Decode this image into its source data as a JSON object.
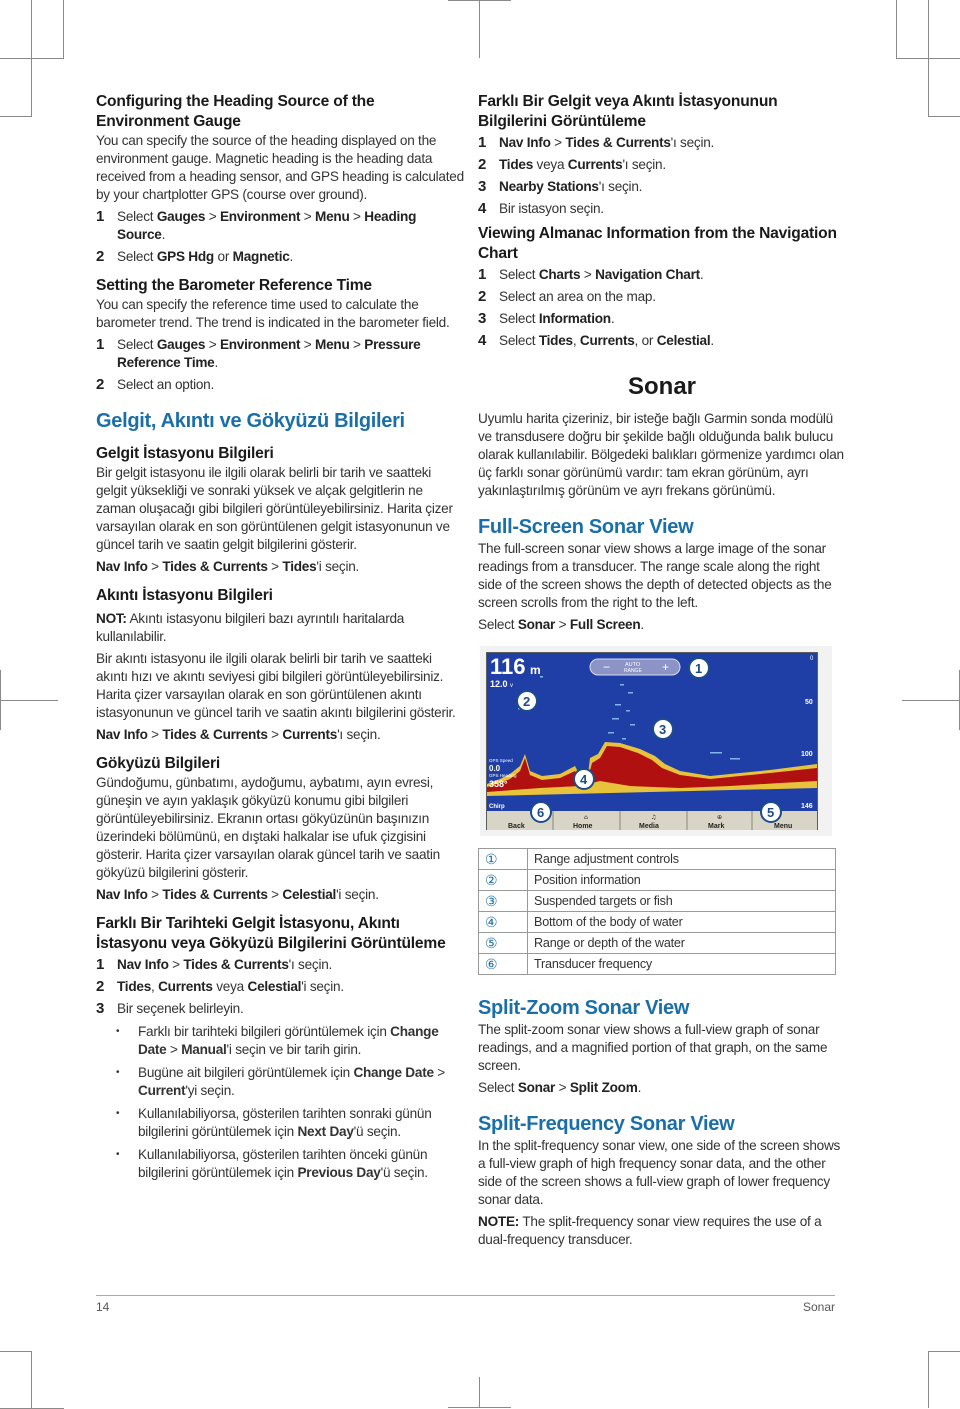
{
  "left": {
    "heading_source": {
      "title": "Configuring the Heading Source of the Environment Gauge",
      "body": "You can specify the source of the heading displayed on the environment gauge. Magnetic heading is the heading data received from a heading sensor, and GPS heading is calculated by your chartplotter GPS (course over ground).",
      "steps": [
        {
          "num": "1",
          "pre": "Select ",
          "b1": "Gauges",
          "s1": " > ",
          "b2": "Environment",
          "s2": " > ",
          "b3": "Menu",
          "s3": " > ",
          "b4": "Heading Source",
          "post": "."
        },
        {
          "num": "2",
          "pre": "Select ",
          "b1": "GPS Hdg",
          "s1": " or ",
          "b2": "Magnetic",
          "post": "."
        }
      ]
    },
    "barometer": {
      "title": "Setting the Barometer Reference Time",
      "body": "You can specify the reference time used to calculate the barometer trend. The trend is indicated in the barometer field.",
      "steps": [
        {
          "num": "1",
          "pre": "Select ",
          "b1": "Gauges",
          "s1": " > ",
          "b2": "Environment",
          "s2": " > ",
          "b3": "Menu",
          "s3": " > ",
          "b4": "Pressure Reference Time",
          "post": "."
        },
        {
          "num": "2",
          "text": "Select an option."
        }
      ]
    },
    "tides_section": {
      "title": "Gelgit, Akıntı ve Gökyüzü Bilgileri",
      "tide_station": {
        "title": "Gelgit İstasyonu Bilgileri",
        "body": "Bir gelgit istasyonu ile ilgili olarak belirli bir tarih ve saatteki gelgit yüksekliği ve sonraki yüksek ve alçak gelgitlerin ne zaman oluşacağı gibi bilgileri görüntüleyebilirsiniz. Harita çizer varsayılan olarak en son görüntülenen gelgit istasyonunun ve güncel tarih ve saatin gelgit bilgilerini gösterir.",
        "path": {
          "b1": "Nav Info",
          "s1": " > ",
          "b2": "Tides & Currents",
          "s2": " > ",
          "b3": "Tides",
          "post": "'i seçin."
        }
      },
      "current_station": {
        "title": "Akıntı İstasyonu Bilgileri",
        "note_label": "NOT:",
        "note_text": " Akıntı istasyonu bilgileri bazı ayrıntılı haritalarda kullanılabilir.",
        "body": "Bir akıntı istasyonu ile ilgili olarak belirli bir tarih ve saatteki akıntı hızı ve akıntı seviyesi gibi bilgileri görüntüleyebilirsiniz. Harita çizer varsayılan olarak en son görüntülenen akıntı istasyonunun ve güncel tarih ve saatin akıntı bilgilerini gösterir.",
        "path": {
          "b1": "Nav Info",
          "s1": " > ",
          "b2": "Tides & Currents",
          "s2": " > ",
          "b3": "Currents",
          "post": "'ı seçin."
        }
      },
      "celestial": {
        "title": "Gökyüzü Bilgileri",
        "body": "Gündoğumu, günbatımı, aydoğumu, aybatımı, ayın evresi, güneşin ve ayın yaklaşık gökyüzü konumu gibi bilgileri görüntüleyebilirsiniz. Ekranın ortası gökyüzünün başınızın üzerindeki bölümünü, en dıştaki halkalar ise ufuk çizgisini gösterir. Harita çizer varsayılan olarak güncel tarih ve saatin gökyüzü bilgilerini gösterir.",
        "path": {
          "b1": "Nav Info",
          "s1": " > ",
          "b2": "Tides & Currents",
          "s2": " > ",
          "b3": "Celestial",
          "post": "'i seçin."
        }
      },
      "different_date": {
        "title": "Farklı Bir Tarihteki Gelgit İstasyonu, Akıntı İstasyonu veya Gökyüzü Bilgilerini Görüntüleme",
        "steps": [
          {
            "num": "1",
            "b1": "Nav Info",
            "s1": " > ",
            "b2": "Tides & Currents",
            "post": "'ı seçin."
          },
          {
            "num": "2",
            "b1": "Tides",
            "s1": ", ",
            "b2": "Currents",
            "s2": " veya ",
            "b3": "Celestial",
            "post": "'i seçin."
          },
          {
            "num": "3",
            "text": "Bir seçenek belirleyin."
          }
        ],
        "bullets": [
          {
            "pre": "Farklı bir tarihteki bilgileri görüntülemek için ",
            "b1": "Change Date",
            "s1": " > ",
            "b2": "Manual",
            "post": "'i seçin ve bir tarih girin."
          },
          {
            "pre": "Bugüne ait bilgileri görüntülemek için ",
            "b1": "Change Date",
            "s1": " > ",
            "b2": "Current",
            "post": "'yi seçin."
          },
          {
            "pre": "Kullanılabiliyorsa, gösterilen tarihten sonraki günün bilgilerini görüntülemek için ",
            "b1": "Next Day",
            "post": "'ü seçin."
          },
          {
            "pre": "Kullanılabiliyorsa, gösterilen tarihten önceki günün bilgilerini görüntülemek için ",
            "b1": "Previous Day",
            "post": "'ü seçin."
          }
        ]
      }
    }
  },
  "right": {
    "different_station": {
      "title": "Farklı Bir Gelgit veya Akıntı İstasyonunun Bilgilerini Görüntüleme",
      "steps": [
        {
          "num": "1",
          "b1": "Nav Info",
          "s1": " > ",
          "b2": "Tides & Currents",
          "post": "'ı seçin."
        },
        {
          "num": "2",
          "b1": "Tides",
          "s1": " veya ",
          "b2": "Currents",
          "post": "'ı seçin."
        },
        {
          "num": "3",
          "b1": "Nearby Stations",
          "post": "'ı seçin."
        },
        {
          "num": "4",
          "text": "Bir istasyon seçin."
        }
      ]
    },
    "almanac": {
      "title": "Viewing Almanac Information from the Navigation Chart",
      "steps": [
        {
          "num": "1",
          "pre": "Select ",
          "b1": "Charts",
          "s1": " > ",
          "b2": "Navigation Chart",
          "post": "."
        },
        {
          "num": "2",
          "text": "Select an area on the map."
        },
        {
          "num": "3",
          "pre": "Select ",
          "b1": "Information",
          "post": "."
        },
        {
          "num": "4",
          "pre": "Select ",
          "b1": "Tides",
          "s1": ", ",
          "b2": "Currents",
          "s2": ", or ",
          "b3": "Celestial",
          "post": "."
        }
      ]
    },
    "sonar": {
      "title": "Sonar",
      "intro": "Uyumlu harita çizeriniz, bir isteğe bağlı Garmin sonda modülü ve transdusere doğru bir şekilde bağlı olduğunda balık bulucu olarak kullanılabilir. Bölgedeki balıkları görmenize yardımcı olan üç farklı sonar görünümü vardır: tam ekran görünüm, ayrı yakınlaştırılmış görünüm ve ayrı frekans görünümü.",
      "full_screen": {
        "title": "Full-Screen Sonar View",
        "body": "The full-screen sonar view shows a large image of the sonar readings from a transducer. The range scale along the right side of the screen shows the depth of detected objects as the screen scrolls from the right to the left.",
        "path": {
          "pre": "Select ",
          "b1": "Sonar",
          "s1": " > ",
          "b2": "Full Screen",
          "post": "."
        }
      },
      "screenshot": {
        "depth": "116",
        "depth_unit": "m",
        "voltage": "12.0",
        "voltage_unit": "v",
        "range_minus": "−",
        "range_label_1": "AUTO",
        "range_label_2": "RANGE",
        "range_plus": "+",
        "scale": [
          "0",
          "50",
          "100",
          "146"
        ],
        "gps_speed_label": "GPS Speed",
        "gps_speed": "0.0",
        "gps_heading_label": "GPS Heading",
        "gps_heading": "358°",
        "freq_label": "Chirp",
        "callouts": [
          "1",
          "2",
          "3",
          "4",
          "5",
          "6"
        ],
        "buttons": [
          {
            "label": "Back",
            "icon": ""
          },
          {
            "label": "Home",
            "icon": "home-icon"
          },
          {
            "label": "Media",
            "icon": "music-note-icon"
          },
          {
            "label": "Mark",
            "icon": "crosshair-icon"
          },
          {
            "label": "Menu",
            "icon": ""
          }
        ],
        "colors": {
          "water": "#1f3fa6",
          "bottom": "#b01010",
          "edge": "#e8c23a",
          "fish": "#7fb6e8"
        }
      },
      "legend": [
        {
          "mark": "①",
          "text": "Range adjustment controls"
        },
        {
          "mark": "②",
          "text": "Position information"
        },
        {
          "mark": "③",
          "text": "Suspended targets or fish"
        },
        {
          "mark": "④",
          "text": "Bottom of the body of water"
        },
        {
          "mark": "⑤",
          "text": "Range or depth of the water"
        },
        {
          "mark": "⑥",
          "text": "Transducer frequency"
        }
      ],
      "split_zoom": {
        "title": "Split-Zoom Sonar View",
        "body": "The split-zoom sonar view shows a full-view graph of sonar readings, and a magnified portion of that graph, on the same screen.",
        "path": {
          "pre": "Select ",
          "b1": "Sonar",
          "s1": " > ",
          "b2": "Split Zoom",
          "post": "."
        }
      },
      "split_freq": {
        "title": "Split-Frequency Sonar View",
        "body": "In the split-frequency sonar view, one side of the screen shows a full-view graph of high frequency sonar data, and the other side of the screen shows a full-view graph of lower frequency sonar data.",
        "note_label": "NOTE:",
        "note_text": " The split-frequency sonar view requires the use of a dual-frequency transducer."
      }
    }
  },
  "footer": {
    "page_number": "14",
    "section": "Sonar"
  },
  "theme": {
    "heading_blue": "#1b6fa8",
    "text": "#333333"
  }
}
